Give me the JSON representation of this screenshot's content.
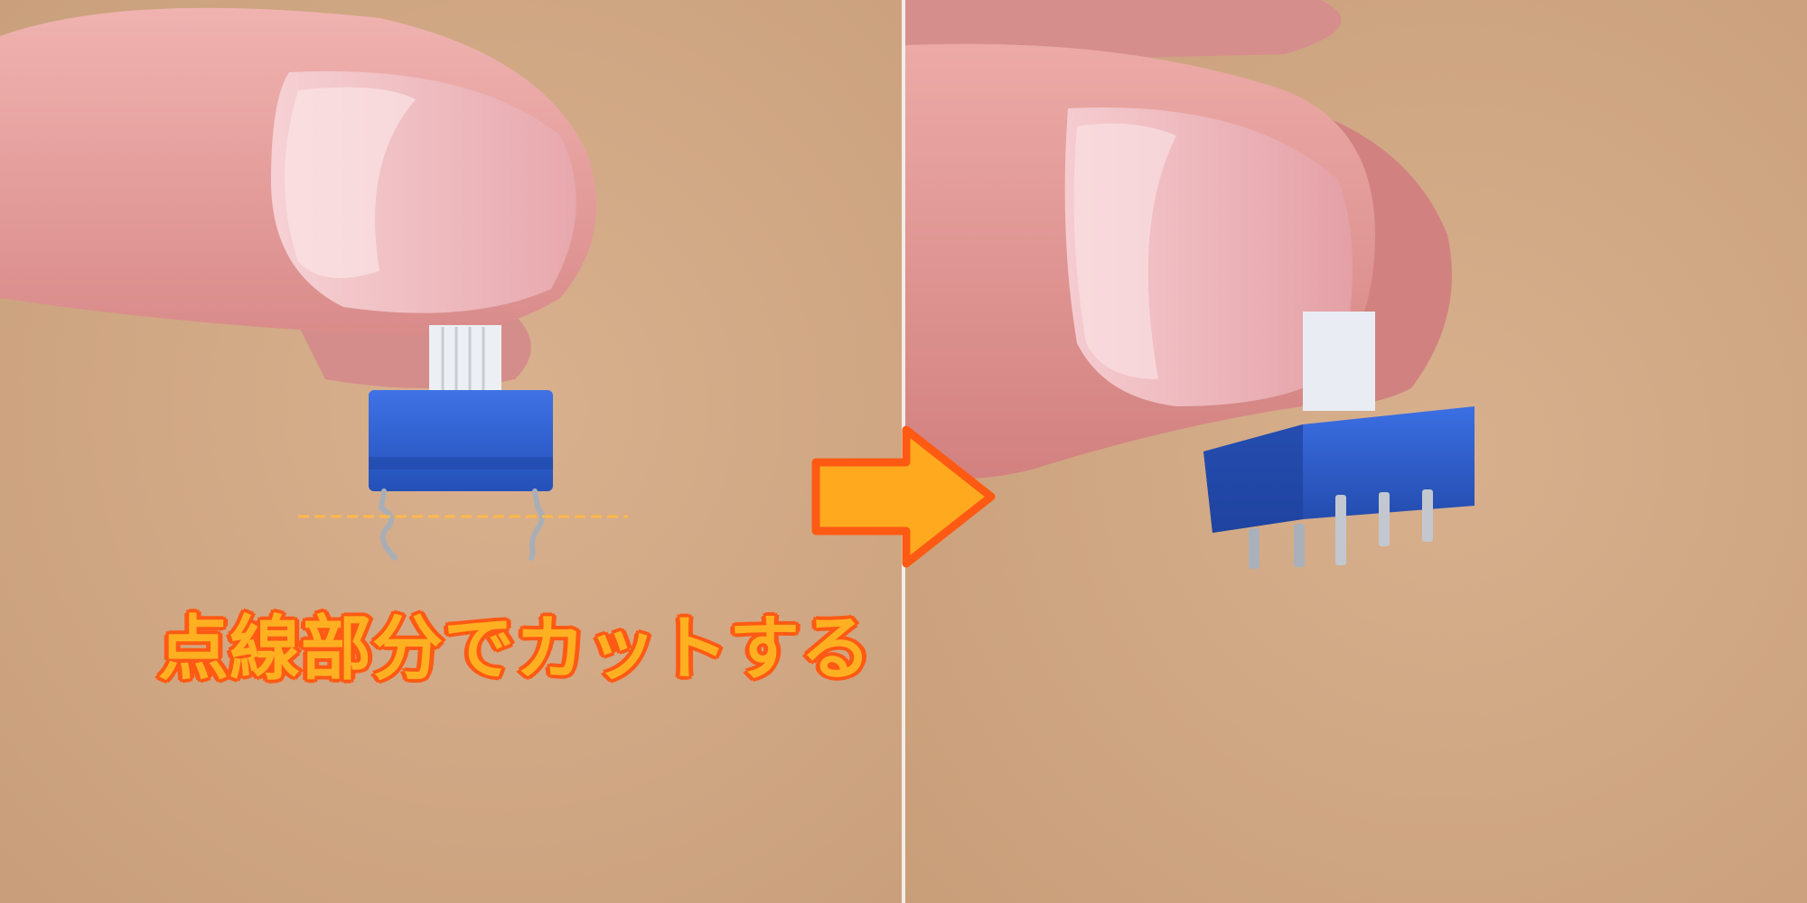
{
  "caption": {
    "text": "点線部分でカットする",
    "fill_color": "#ffb021",
    "outline_color": "#ff5a14"
  },
  "arrow": {
    "icon": "right-arrow-icon",
    "fill_color": "#ffaa1e",
    "outline_color": "#ff5a14"
  },
  "cut_line": {
    "color": "#ffb84a",
    "style": "dashed"
  },
  "colors": {
    "background": "#d8b08c",
    "switch_body": "#2f5fd0",
    "skin": "#e9a9a6",
    "divider": "#f2ede6"
  },
  "panels": [
    {
      "id": "before",
      "content": "fingers-holding-switch-with-bent-leads"
    },
    {
      "id": "after",
      "content": "fingers-holding-switch-with-trimmed-pins"
    }
  ]
}
